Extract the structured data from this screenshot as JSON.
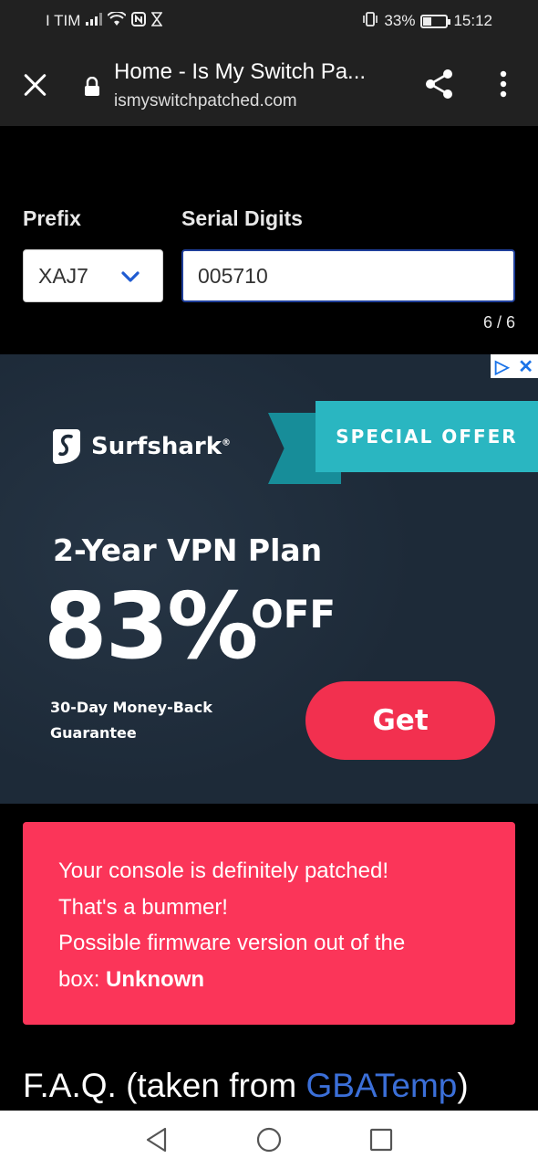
{
  "status_bar": {
    "carrier": "I TIM",
    "battery_percent": "33%",
    "battery_level": 0.33,
    "time": "15:12"
  },
  "browser": {
    "page_title": "Home - Is My Switch Pa...",
    "url": "ismyswitchpatched.com"
  },
  "form": {
    "prefix_label": "Prefix",
    "prefix_value": "XAJ7",
    "serial_label": "Serial Digits",
    "serial_value": "005710",
    "counter": "6 / 6"
  },
  "ad": {
    "brand": "Surfshark",
    "brand_mark": "®",
    "ribbon": "SPECIAL OFFER",
    "plan": "2-Year VPN Plan",
    "percent": "83%",
    "off": "OFF",
    "guarantee": "30-Day Money-Back Guarantee",
    "cta": "Get",
    "colors": {
      "background": "#1d2a38",
      "ribbon": "#2ab6c1",
      "cta": "#f2304f"
    }
  },
  "result": {
    "line1": "Your console is definitely patched!",
    "line2": "That's a bummer!",
    "line3": "Possible firmware version out of the",
    "line4_prefix": "box: ",
    "firmware": "Unknown",
    "color": "#fb3559"
  },
  "faq": {
    "title_prefix": "F.A.Q. (taken from ",
    "link": "GBATemp",
    "title_suffix": ")"
  }
}
